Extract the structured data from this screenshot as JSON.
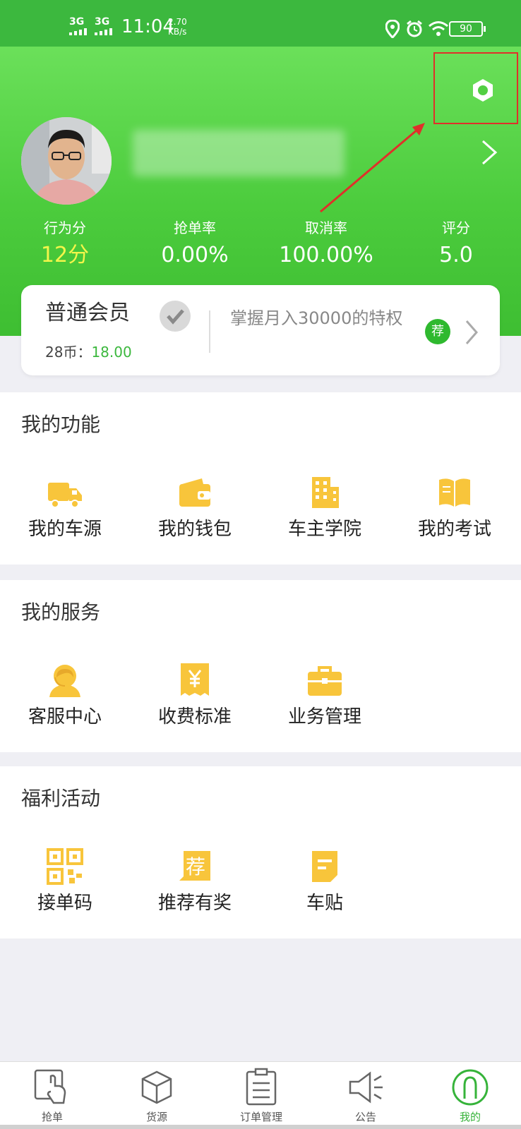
{
  "status_bar": {
    "net1": "3G",
    "net2": "3G",
    "time": "11:04",
    "speed_value": "2.70",
    "speed_unit": "KB/s",
    "battery": "90"
  },
  "profile": {
    "stats": [
      {
        "label": "行为分",
        "value": "12分"
      },
      {
        "label": "抢单率",
        "value": "0.00%"
      },
      {
        "label": "取消率",
        "value": "100.00%"
      },
      {
        "label": "评分",
        "value": "5.0"
      }
    ]
  },
  "membership": {
    "title": "普通会员",
    "coins_label": "28币：",
    "coins_value": "18.00",
    "promo": "掌握月入30000的特权",
    "badge": "荐"
  },
  "sections": [
    {
      "title": "我的功能",
      "items": [
        {
          "label": "我的车源",
          "icon": "truck-icon"
        },
        {
          "label": "我的钱包",
          "icon": "wallet-icon"
        },
        {
          "label": "车主学院",
          "icon": "building-icon"
        },
        {
          "label": "我的考试",
          "icon": "book-icon"
        }
      ]
    },
    {
      "title": "我的服务",
      "items": [
        {
          "label": "客服中心",
          "icon": "customer-service-icon"
        },
        {
          "label": "收费标准",
          "icon": "receipt-yen-icon"
        },
        {
          "label": "业务管理",
          "icon": "briefcase-icon"
        }
      ]
    },
    {
      "title": "福利活动",
      "items": [
        {
          "label": "接单码",
          "icon": "qr-code-icon"
        },
        {
          "label": "推荐有奖",
          "icon": "recommend-icon"
        },
        {
          "label": "车贴",
          "icon": "sticker-icon"
        }
      ]
    }
  ],
  "tabbar": [
    {
      "label": "抢单",
      "icon": "grab-order-icon"
    },
    {
      "label": "货源",
      "icon": "box-icon"
    },
    {
      "label": "订单管理",
      "icon": "clipboard-icon"
    },
    {
      "label": "公告",
      "icon": "megaphone-icon"
    },
    {
      "label": "我的",
      "icon": "person-icon",
      "active": true
    }
  ],
  "colors": {
    "brand_green": "#3cb83e",
    "icon_yellow": "#f8c53b",
    "highlight_yellow": "#f3f54a",
    "annotation_red": "#e0302a"
  }
}
